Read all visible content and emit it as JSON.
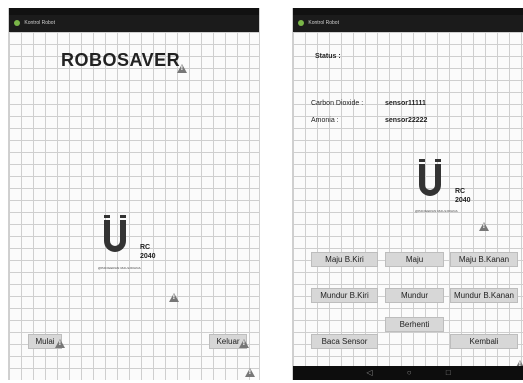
{
  "left_screen": {
    "window_title": "Kontrol Robot",
    "main_title": "ROBOSAVER",
    "logo": {
      "letter": "U",
      "rc": "RC",
      "number": "2040",
      "caption": "@PANGERAN MAULIDIANA"
    },
    "buttons": {
      "start": "Mulai",
      "exit": "Keluar"
    }
  },
  "right_screen": {
    "window_title": "Kontrol Robot",
    "status_label": "Status :",
    "readings": [
      {
        "label": "Carbon Dioxide :",
        "value": "sensor11111"
      },
      {
        "label": "Amonia :",
        "value": "sensor22222"
      }
    ],
    "logo": {
      "letter": "U",
      "rc": "RC",
      "number": "2040",
      "caption": "@PANGERAN MAULIDIANA"
    },
    "buttons": {
      "forward_left": "Maju B.Kiri",
      "forward": "Maju",
      "forward_right": "Maju B.Kanan",
      "back_left": "Mundur B.Kiri",
      "back": "Mundur",
      "back_right": "Mundur B.Kanan",
      "stop": "Berhenti",
      "read_sensor": "Baca Sensor",
      "return": "Kembali"
    },
    "nav_icons": [
      "back-icon",
      "home-icon",
      "recents-icon"
    ]
  },
  "colors": {
    "button_bg": "#d7d7d7",
    "titlebar": "#1b1b1b",
    "grid": "#cfcfcf"
  }
}
